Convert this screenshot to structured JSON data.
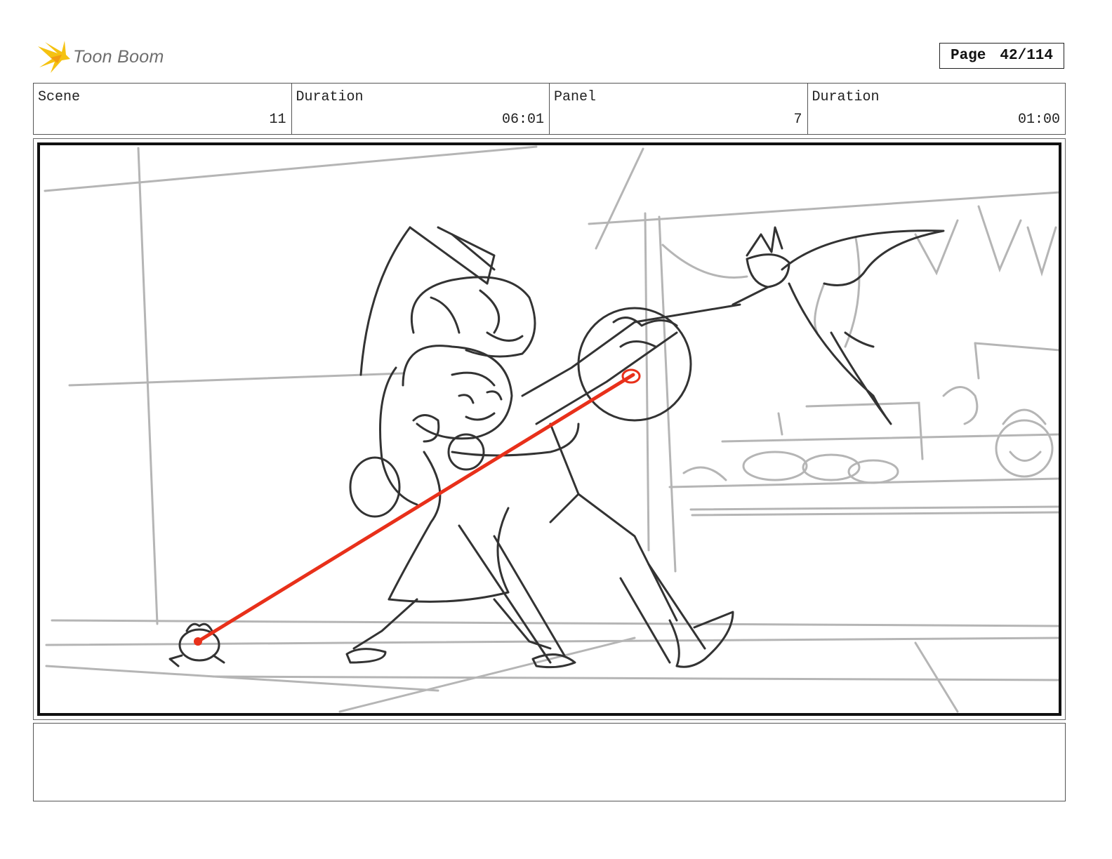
{
  "brand": {
    "name": "Toon Boom"
  },
  "page": {
    "label": "Page",
    "number": "42/114"
  },
  "info": {
    "scene_label": "Scene",
    "scene_value": "11",
    "scene_duration_label": "Duration",
    "scene_duration_value": "06:01",
    "panel_label": "Panel",
    "panel_value": "7",
    "panel_duration_label": "Duration",
    "panel_duration_value": "01:00"
  },
  "colors": {
    "sketch": "#333333",
    "background_sketch": "#b5b5b5",
    "laser": "#e8301a",
    "logo": "#f5c211"
  },
  "notes": {
    "text": ""
  }
}
